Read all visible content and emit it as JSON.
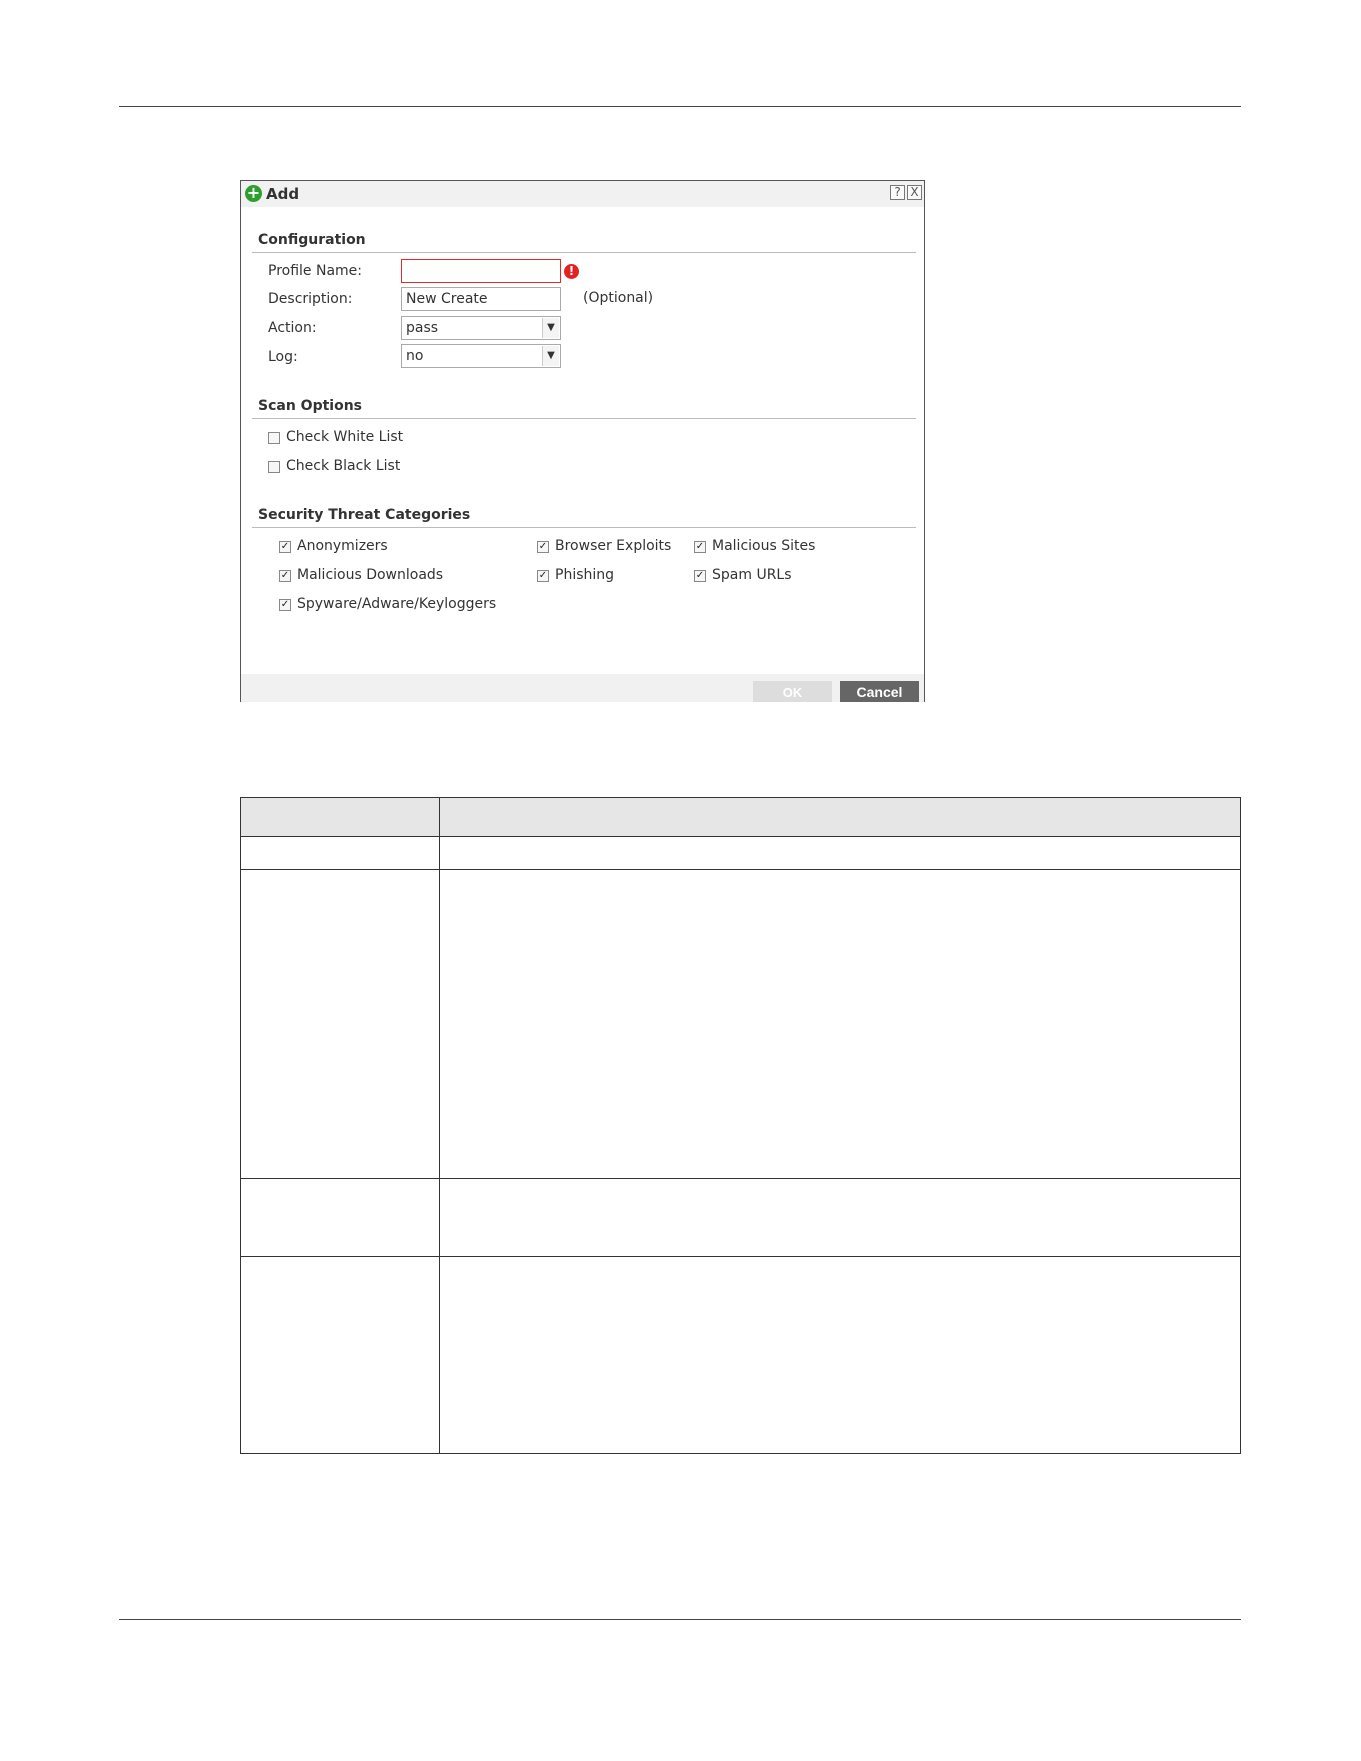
{
  "dialog": {
    "title": "Add",
    "help_glyph": "?",
    "close_glyph": "X",
    "sections": {
      "configuration": "Configuration",
      "scan_options": "Scan Options",
      "security_threat_categories": "Security Threat Categories"
    },
    "fields": {
      "profile_name": {
        "label": "Profile Name:",
        "value": ""
      },
      "description": {
        "label": "Description:",
        "value": "New Create",
        "note": "(Optional)"
      },
      "action": {
        "label": "Action:",
        "selected": "pass"
      },
      "log": {
        "label": "Log:",
        "selected": "no"
      }
    },
    "scan_options": [
      {
        "label": "Check White List",
        "checked": false
      },
      {
        "label": "Check Black List",
        "checked": false
      }
    ],
    "categories": [
      {
        "label": "Anonymizers",
        "checked": true
      },
      {
        "label": "Browser Exploits",
        "checked": true
      },
      {
        "label": "Malicious Sites",
        "checked": true
      },
      {
        "label": "Malicious Downloads",
        "checked": true
      },
      {
        "label": "Phishing",
        "checked": true
      },
      {
        "label": "Spam URLs",
        "checked": true
      },
      {
        "label": "Spyware/Adware/Keyloggers",
        "checked": true
      }
    ],
    "buttons": {
      "ok": "OK",
      "cancel": "Cancel"
    },
    "error_glyph": "!"
  },
  "colors": {
    "accent_green": "#2e9e2e",
    "error_red": "#e52222",
    "cancel_button": "#666666",
    "ok_button_disabled": "#dddddd"
  }
}
